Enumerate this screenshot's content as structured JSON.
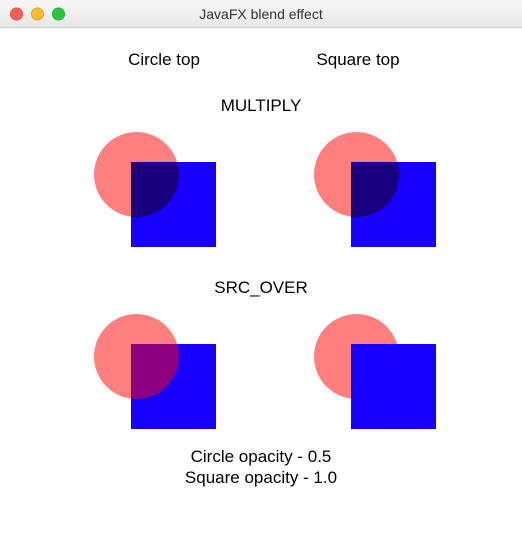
{
  "window": {
    "title": "JavaFX blend effect"
  },
  "columns": {
    "left": "Circle top",
    "right": "Square top"
  },
  "modes": {
    "row1": "MULTIPLY",
    "row2": "SRC_OVER"
  },
  "opacity": {
    "circle_label": "Circle opacity - 0.5",
    "square_label": "Square opacity - 1.0",
    "circle_value": 0.5,
    "square_value": 1.0
  },
  "colors": {
    "circle": "#ff0000",
    "square": "#1800ff"
  }
}
